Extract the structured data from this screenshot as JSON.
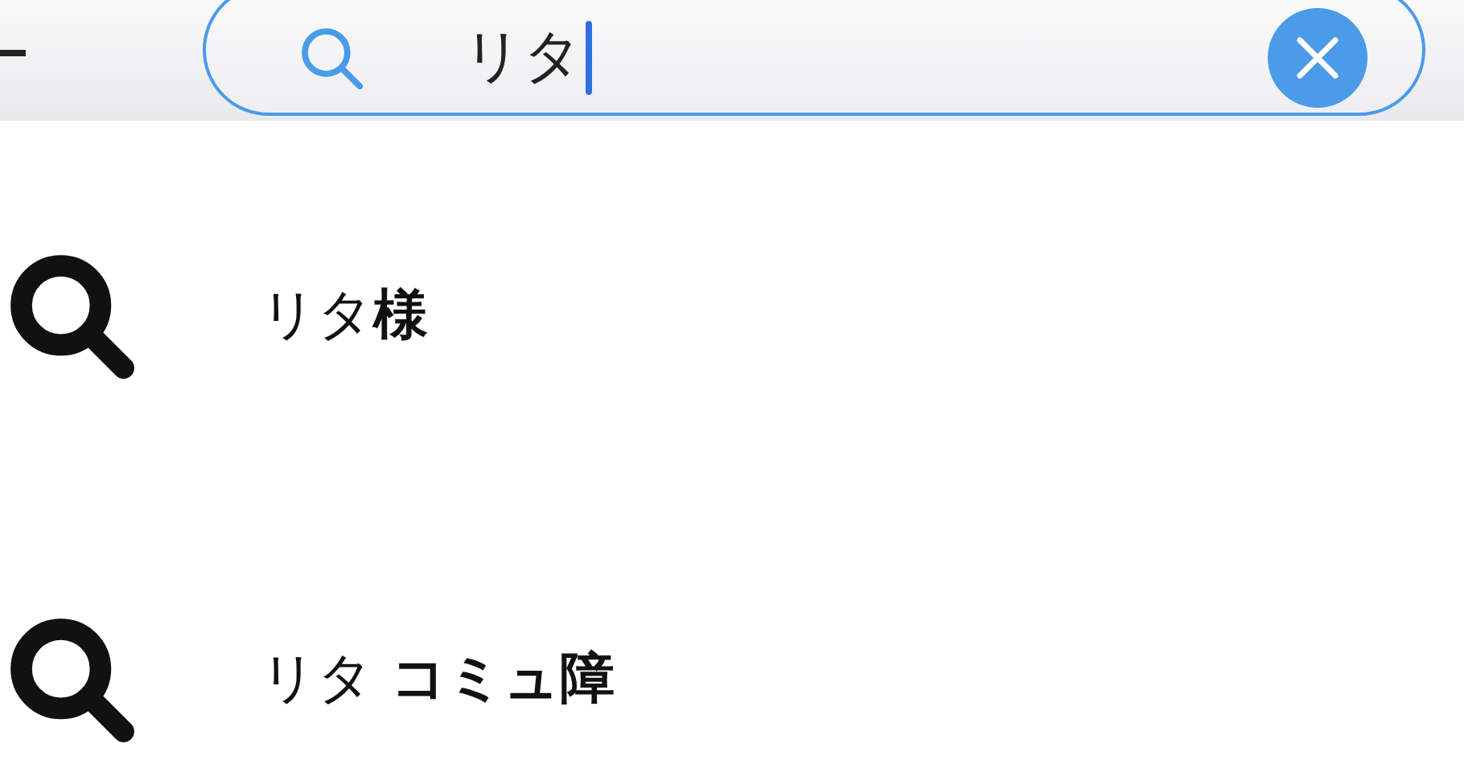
{
  "search": {
    "value": "リタ"
  },
  "suggestions": [
    {
      "text": "リタ**様**"
    },
    {
      "text": "リタ **コミュ障**"
    }
  ]
}
